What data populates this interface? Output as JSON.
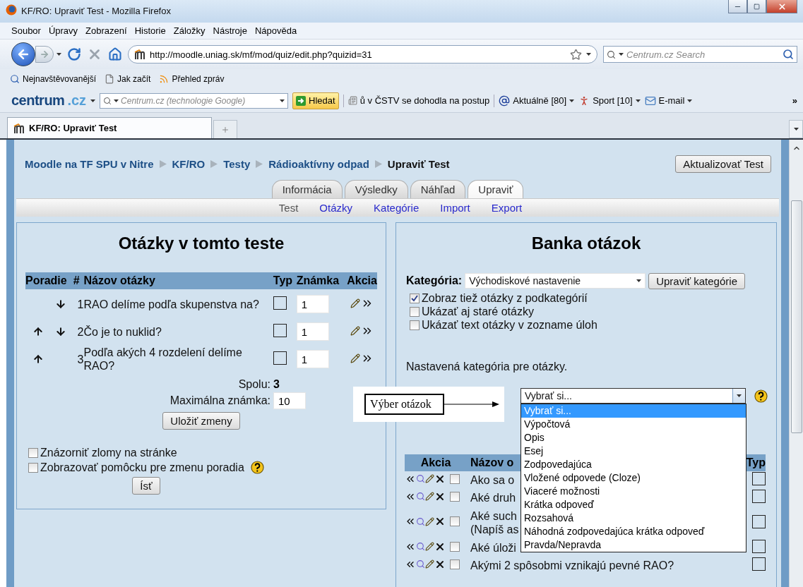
{
  "window": {
    "title": "KF/RO: Upraviť Test - Mozilla Firefox"
  },
  "menu": [
    "Soubor",
    "Úpravy",
    "Zobrazení",
    "Historie",
    "Záložky",
    "Nástroje",
    "Nápověda"
  ],
  "navigation": {
    "url": "http://moodle.uniag.sk/mf/mod/quiz/edit.php?quizid=31",
    "search_placeholder": "Centrum.cz Search"
  },
  "bookmarks": [
    {
      "label": "Nejnavštěvovanější",
      "kind": "search"
    },
    {
      "label": "Jak začít",
      "kind": "page"
    },
    {
      "label": "Přehled zpráv",
      "kind": "feed"
    }
  ],
  "centrum_toolbar": {
    "logo_main": "centrum",
    "logo_suffix": ".cz",
    "search_placeholder": "Centrum.cz (technologie Google)",
    "search_button": "Hledat",
    "items": [
      {
        "label": "ů v ČSTV se dohodla na postup",
        "kind": "news"
      },
      {
        "label": "Aktuálně [80]",
        "kind": "at"
      },
      {
        "label": "Sport [10]",
        "kind": "sport"
      },
      {
        "label": "E-mail",
        "kind": "mail"
      }
    ],
    "overflow": "»"
  },
  "browser_tabs": [
    {
      "label": "KF/RO: Upraviť Test",
      "selected": true
    }
  ],
  "page": {
    "breadcrumb": [
      {
        "label": "Moodle na TF SPU v Nitre",
        "link": true
      },
      {
        "label": "KF/RO",
        "link": true
      },
      {
        "label": "Testy",
        "link": true
      },
      {
        "label": "Rádioaktívny odpad",
        "link": true
      },
      {
        "label": "Upraviť Test",
        "link": false
      }
    ],
    "update_button": "Aktualizovať Test",
    "tabs": [
      {
        "label": "Informácia",
        "selected": false
      },
      {
        "label": "Výsledky",
        "selected": false
      },
      {
        "label": "Náhľad",
        "selected": false
      },
      {
        "label": "Upraviť",
        "selected": true
      }
    ],
    "subtabs": [
      {
        "label": "Test",
        "selected": true
      },
      {
        "label": "Otázky",
        "selected": false
      },
      {
        "label": "Kategórie",
        "selected": false
      },
      {
        "label": "Import",
        "selected": false
      },
      {
        "label": "Export",
        "selected": false
      }
    ]
  },
  "left_panel": {
    "title": "Otázky v tomto teste",
    "columns": [
      "Poradie",
      "#",
      "Názov otázky",
      "Typ",
      "Známka",
      "Akcia"
    ],
    "rows": [
      {
        "can_move_up": false,
        "can_move_down": true,
        "number": "1",
        "name": "RAO delíme podľa skupenstva na?",
        "grade": "1"
      },
      {
        "can_move_up": true,
        "can_move_down": true,
        "number": "2",
        "name": "Čo je to nuklid?",
        "grade": "1"
      },
      {
        "can_move_up": true,
        "can_move_down": false,
        "number": "3",
        "name": "Podľa akých 4 rozdelení delíme RAO?",
        "grade": "1"
      }
    ],
    "total_label": "Spolu:",
    "total": "3",
    "max_label": "Maximálna známka:",
    "max_value": "10",
    "save_button": "Uložiť zmeny",
    "options": [
      {
        "label": "Znázorniť zlomy na stránke",
        "checked": false,
        "help": false
      },
      {
        "label": "Zobrazovať pomôcku pre zmenu poradia",
        "checked": false,
        "help": true
      }
    ],
    "go_button": "Ísť"
  },
  "right_panel": {
    "title": "Banka otázok",
    "category_label": "Kategória:",
    "category_value": "Východiskové nastavenie",
    "edit_categories_button": "Upraviť kategórie",
    "options": [
      {
        "label": "Zobraz tiež otázky z podkategórií",
        "checked": true
      },
      {
        "label": "Ukázať aj staré otázky",
        "checked": false
      },
      {
        "label": "Ukázať text otázky v zozname úloh",
        "checked": false
      }
    ],
    "note": "Nastavená kategória pre otázky.",
    "create_select": {
      "value": "Vybrať si...",
      "expanded": true,
      "options": [
        {
          "label": "Vybrať si...",
          "selected": true
        },
        {
          "label": "Výpočtová",
          "selected": false
        },
        {
          "label": "Opis",
          "selected": false
        },
        {
          "label": "Esej",
          "selected": false
        },
        {
          "label": "Zodpovedajúca",
          "selected": false
        },
        {
          "label": "Vložené odpovede (Cloze)",
          "selected": false
        },
        {
          "label": "Viaceré možnosti",
          "selected": false
        },
        {
          "label": "Krátka odpoveď",
          "selected": false
        },
        {
          "label": "Rozsahová",
          "selected": false
        },
        {
          "label": "Náhodná zodpovedajúca krátka odpoveď",
          "selected": false
        },
        {
          "label": "Pravda/Nepravda",
          "selected": false
        }
      ]
    },
    "columns": [
      "Akcia",
      "Názov o",
      "Typ"
    ],
    "rows": [
      {
        "lines": [
          "Ako sa o"
        ],
        "checked": false
      },
      {
        "lines": [
          "Aké druh"
        ],
        "checked": false
      },
      {
        "lines": [
          "Aké such",
          "(Napíš as"
        ],
        "checked": false
      },
      {
        "lines": [
          "Aké úloži"
        ],
        "checked": false
      },
      {
        "lines": [
          "Akými 2 spôsobmi vznikajú pevné RAO?"
        ],
        "checked": false
      }
    ]
  },
  "annotation": {
    "label": "Výber otázok"
  }
}
